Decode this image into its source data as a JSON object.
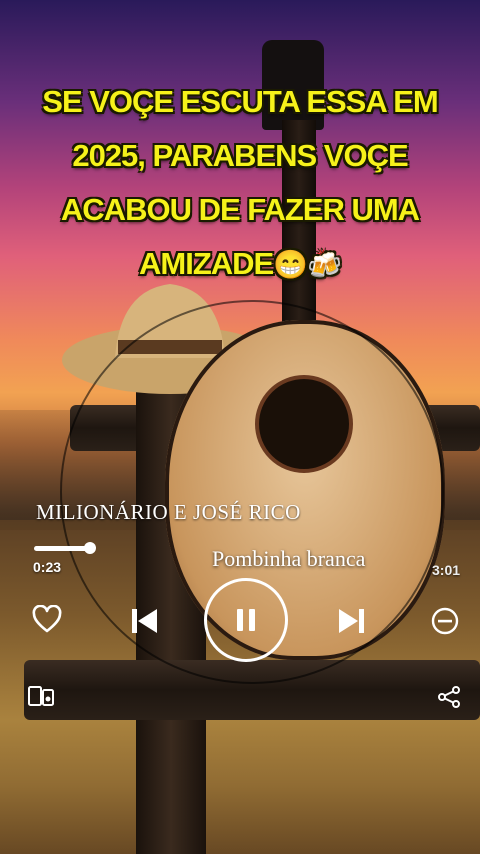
{
  "caption": {
    "line1": "SE VOÇE ESCUTA ESSA EM",
    "line2": "2025, PARABENS VOÇE",
    "line3": "ACABOU DE FAZER UMA",
    "line4": "AMIZADE",
    "emoji": "😁🍻"
  },
  "player": {
    "artist": "MILIONÁRIO E JOSÉ RICO",
    "song": "Pombinha branca",
    "elapsed": "0:23",
    "total": "3:01",
    "progress_fraction": 0.13,
    "state": "playing"
  },
  "icons": {
    "like": "heart-icon",
    "previous": "skip-previous-icon",
    "play_pause": "pause-icon",
    "next": "skip-next-icon",
    "remove": "minus-circle-icon",
    "device": "speaker-device-icon",
    "share": "share-icon"
  },
  "colors": {
    "caption_text": "#f6f21a",
    "caption_outline": "#1a1a00",
    "controls": "#ffffff"
  }
}
